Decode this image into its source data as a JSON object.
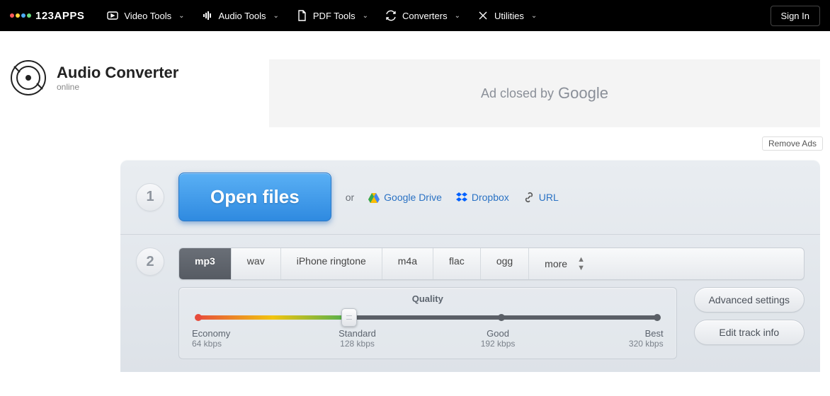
{
  "header": {
    "brand": "123APPS",
    "nav": [
      {
        "label": "Video Tools",
        "icon": "video-icon"
      },
      {
        "label": "Audio Tools",
        "icon": "audio-icon"
      },
      {
        "label": "PDF Tools",
        "icon": "pdf-icon"
      },
      {
        "label": "Converters",
        "icon": "convert-icon"
      },
      {
        "label": "Utilities",
        "icon": "utilities-icon"
      }
    ],
    "signin": "Sign In"
  },
  "title": {
    "heading": "Audio Converter",
    "subtitle": "online"
  },
  "ad": {
    "text": "Ad closed by",
    "brand": "Google",
    "remove": "Remove Ads"
  },
  "step1": {
    "num": "1",
    "open": "Open files",
    "or": "or",
    "sources": [
      {
        "name": "google-drive",
        "label": "Google Drive"
      },
      {
        "name": "dropbox",
        "label": "Dropbox"
      },
      {
        "name": "url",
        "label": "URL"
      }
    ]
  },
  "step2": {
    "num": "2",
    "formats": [
      "mp3",
      "wav",
      "iPhone ringtone",
      "m4a",
      "flac",
      "ogg",
      "more"
    ],
    "active_format": "mp3",
    "quality": {
      "title": "Quality",
      "ticks": [
        {
          "label": "Economy",
          "sub": "64 kbps"
        },
        {
          "label": "Standard",
          "sub": "128 kbps"
        },
        {
          "label": "Good",
          "sub": "192 kbps"
        },
        {
          "label": "Best",
          "sub": "320 kbps"
        }
      ]
    },
    "advanced": "Advanced settings",
    "edit_track": "Edit track info"
  }
}
